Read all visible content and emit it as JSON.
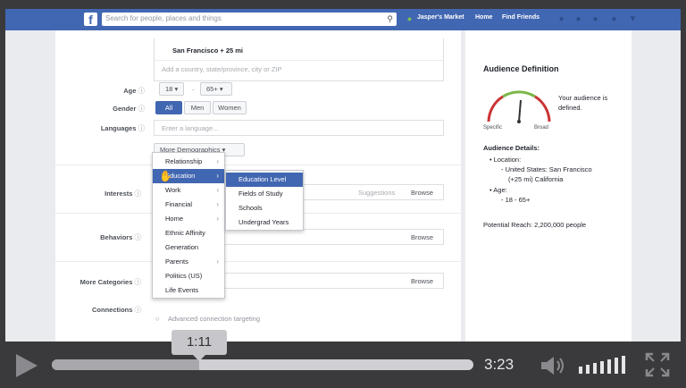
{
  "fb": {
    "logo": "f",
    "search_placeholder": "Search for people, places and things",
    "nav": [
      "Jasper's Market",
      "Home",
      "Find Friends"
    ]
  },
  "form": {
    "location_value": "San Francisco + 25 mi",
    "location_placeholder": "Add a country, state/province, city or ZIP",
    "age_label": "Age",
    "age_min": "18",
    "age_sep": "-",
    "age_max": "65+",
    "gender_label": "Gender",
    "gender_options": [
      "All",
      "Men",
      "Women"
    ],
    "languages_label": "Languages",
    "languages_placeholder": "Enter a language...",
    "more_demographics": "More Demographics",
    "interests_label": "Interests",
    "suggestions": "Suggestions",
    "browse": "Browse",
    "behaviors_label": "Behaviors",
    "more_categories_label": "More Categories",
    "connections_label": "Connections",
    "connections_option": "Advanced connection targeting"
  },
  "demographics_menu": [
    "Relationship",
    "Education",
    "Work",
    "Financial",
    "Home",
    "Ethnic Affinity",
    "Generation",
    "Parents",
    "Politics (US)",
    "Life Events"
  ],
  "education_submenu": [
    "Education Level",
    "Fields of Study",
    "Schools",
    "Undergrad Years"
  ],
  "audience": {
    "title": "Audience Definition",
    "gauge_specific": "Specific",
    "gauge_broad": "Broad",
    "status": "Your audience is defined.",
    "details_title": "Audience Details:",
    "location_head": "Location:",
    "location_item1": "United States: San Francisco",
    "location_item2": "(+25 mi) California",
    "age_head": "Age:",
    "age_item": "18 - 65+",
    "reach": "Potential Reach: 2,200,000 people"
  },
  "player": {
    "tooltip_time": "1:11",
    "duration": "3:23",
    "progress_fraction": 0.35
  },
  "colors": {
    "fb_blue": "#4267b2"
  }
}
